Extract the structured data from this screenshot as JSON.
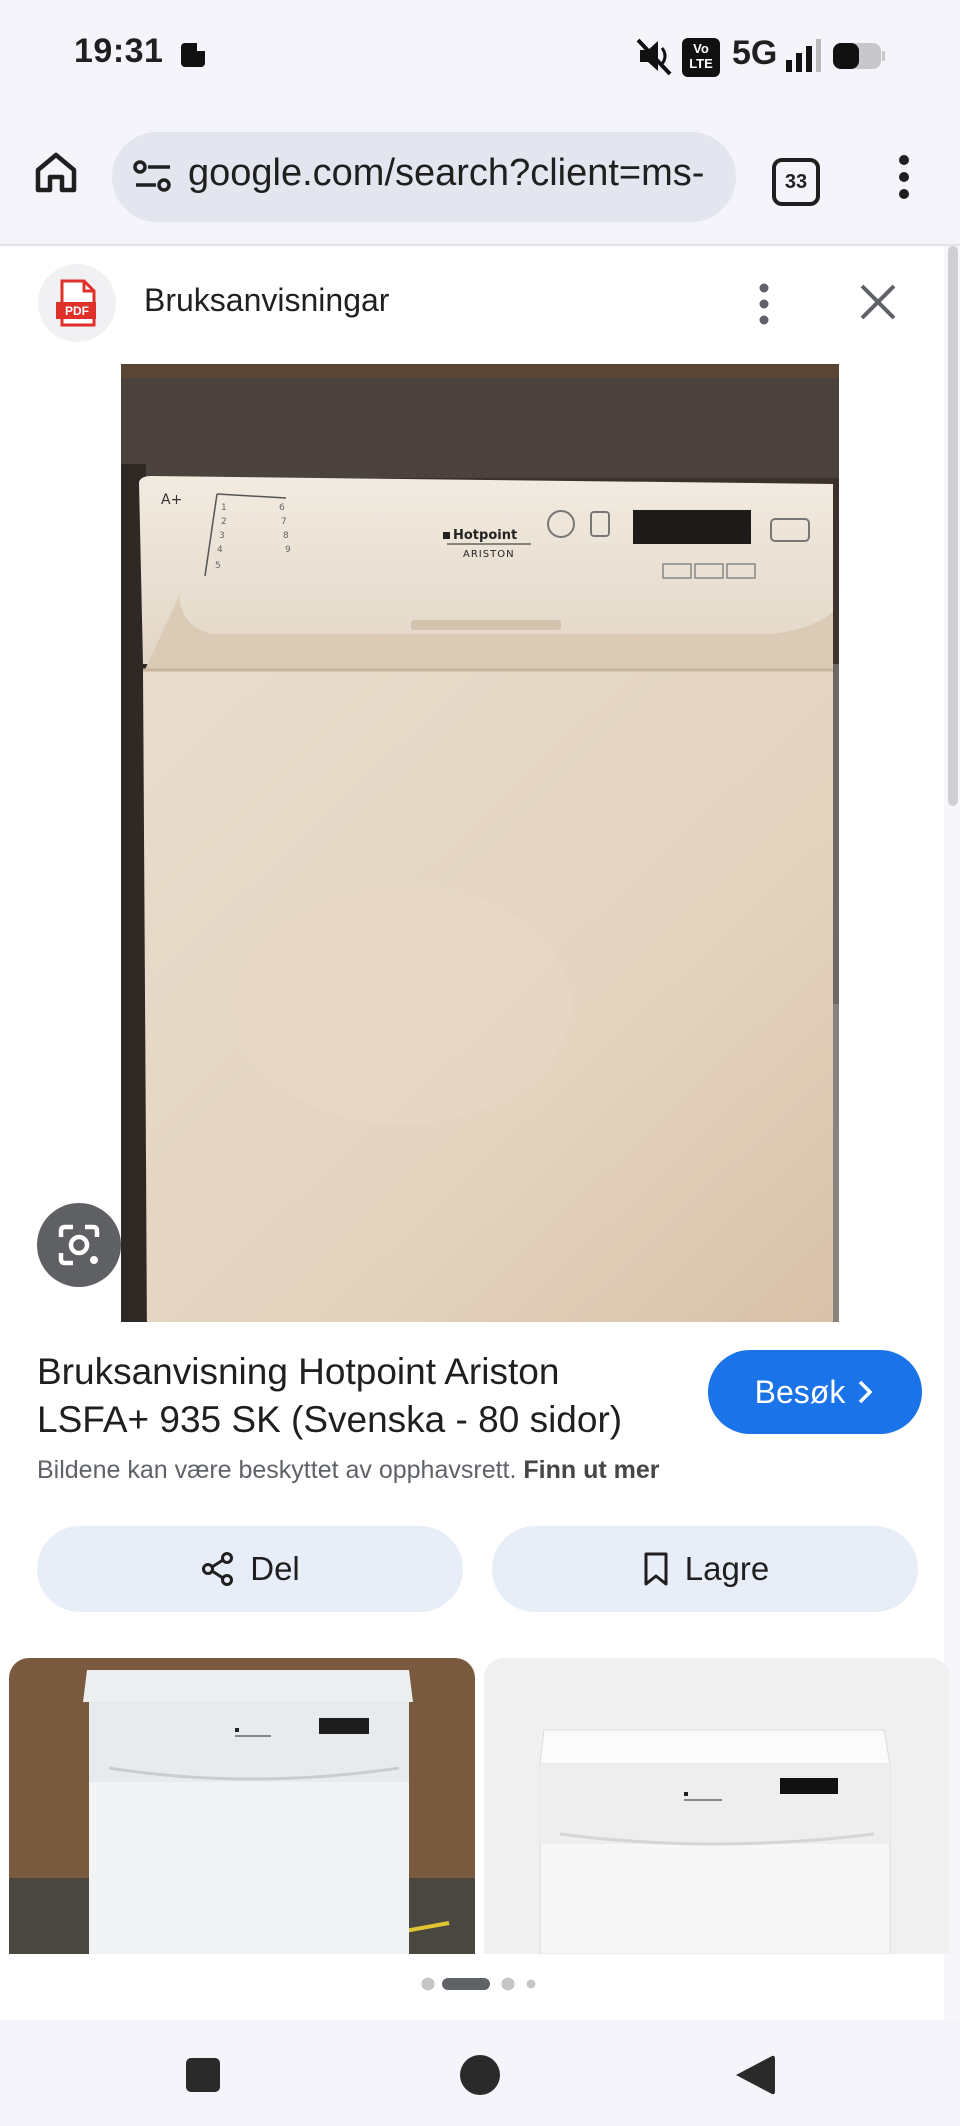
{
  "status_bar": {
    "time": "19:31",
    "network": "5G",
    "volte": "Vo\nLTE",
    "icons": [
      "stop-icon",
      "mute-icon",
      "volte-icon",
      "signal-icon",
      "battery-icon"
    ]
  },
  "browser": {
    "url": "google.com/search?client=ms-",
    "tab_count": "33",
    "icons": [
      "home-icon",
      "tune-icon",
      "tab-switcher-icon",
      "menu-icon"
    ]
  },
  "panel": {
    "source_name": "Bruksanvisningar",
    "pdf_badge": "PDF",
    "title": "Bruksanvisning Hotpoint Ariston LSFA+ 935 SK (Svenska - 80 sidor)",
    "visit_label": "Besøk",
    "copyright_text": "Bildene kan være beskyttet av opphavsrett.",
    "learn_more": "Finn ut mer",
    "share_label": "Del",
    "save_label": "Lagre",
    "brand_top": "Hotpoint",
    "brand_bottom": "ARISTON"
  },
  "carousel": {
    "total": 4,
    "active": 1
  },
  "colors": {
    "accent": "#1a73e8",
    "pill": "#e8eef8",
    "panel_bg": "#ffffff",
    "chrome": "#f4f4fa"
  }
}
